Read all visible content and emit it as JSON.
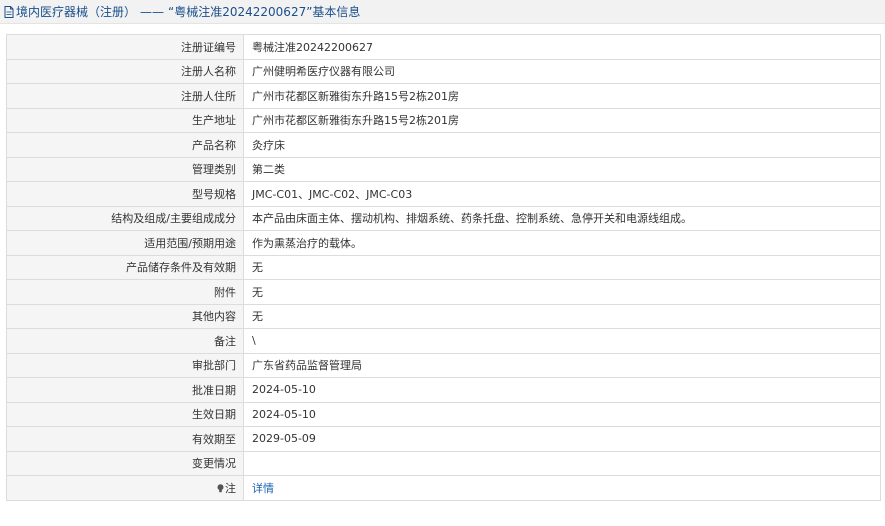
{
  "header": {
    "category": "境内医疗器械（注册）",
    "separator": "——",
    "record_title": "“粤械注准20242200627”基本信息"
  },
  "rows": [
    {
      "label": "注册证编号",
      "value": "粤械注准20242200627"
    },
    {
      "label": "注册人名称",
      "value": "广州健明希医疗仪器有限公司"
    },
    {
      "label": "注册人住所",
      "value": "广州市花都区新雅街东升路15号2栋201房"
    },
    {
      "label": "生产地址",
      "value": "广州市花都区新雅街东升路15号2栋201房"
    },
    {
      "label": "产品名称",
      "value": "灸疗床"
    },
    {
      "label": "管理类别",
      "value": "第二类"
    },
    {
      "label": "型号规格",
      "value": "JMC-C01、JMC-C02、JMC-C03"
    },
    {
      "label": "结构及组成/主要组成成分",
      "value": "本产品由床面主体、摆动机构、排烟系统、药条托盘、控制系统、急停开关和电源线组成。"
    },
    {
      "label": "适用范围/预期用途",
      "value": "作为熏蒸治疗的载体。"
    },
    {
      "label": "产品储存条件及有效期",
      "value": "无"
    },
    {
      "label": "附件",
      "value": "无"
    },
    {
      "label": "其他内容",
      "value": "无"
    },
    {
      "label": "备注",
      "value": "\\"
    },
    {
      "label": "审批部门",
      "value": "广东省药品监督管理局"
    },
    {
      "label": "批准日期",
      "value": "2024-05-10"
    },
    {
      "label": "生效日期",
      "value": "2024-05-10"
    },
    {
      "label": "有效期至",
      "value": "2029-05-09"
    },
    {
      "label": "变更情况",
      "value": ""
    }
  ],
  "note_row": {
    "label": "注",
    "icon": "lightbulb-icon",
    "link_text": "详情"
  }
}
